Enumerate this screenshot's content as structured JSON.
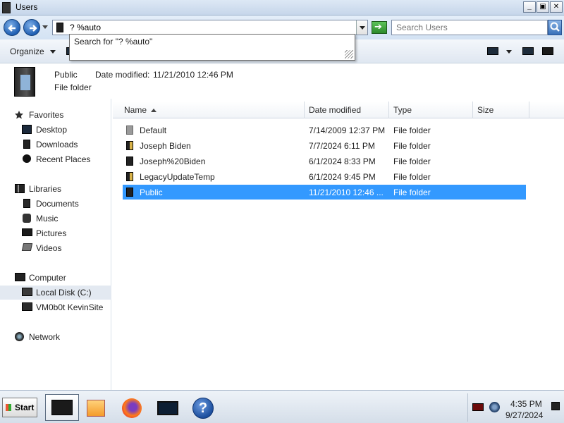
{
  "window": {
    "title": "Users"
  },
  "address": {
    "value": "? %auto",
    "autocomplete_item": "Search for \"? %auto\""
  },
  "search": {
    "placeholder": "Search Users"
  },
  "toolbar": {
    "organize_label": "Organize"
  },
  "details": {
    "name": "Public",
    "type": "File folder",
    "date_modified_label": "Date modified:",
    "date_modified_value": "11/21/2010 12:46 PM"
  },
  "sidebar": {
    "favorites": {
      "label": "Favorites",
      "items": [
        "Desktop",
        "Downloads",
        "Recent Places"
      ]
    },
    "libraries": {
      "label": "Libraries",
      "items": [
        "Documents",
        "Music",
        "Pictures",
        "Videos"
      ]
    },
    "computer": {
      "label": "Computer",
      "items": [
        "Local Disk (C:)",
        "VM0b0t KevinSite"
      ]
    },
    "network": {
      "label": "Network"
    }
  },
  "columns": [
    "Name",
    "Date modified",
    "Type",
    "Size"
  ],
  "files": [
    {
      "name": "Default",
      "date": "7/14/2009 12:37 PM",
      "type": "File folder"
    },
    {
      "name": "Joseph Biden",
      "date": "7/7/2024 6:11 PM",
      "type": "File folder"
    },
    {
      "name": "Joseph%20Biden",
      "date": "6/1/2024 8:33 PM",
      "type": "File folder"
    },
    {
      "name": "LegacyUpdateTemp",
      "date": "6/1/2024 9:45 PM",
      "type": "File folder"
    },
    {
      "name": "Public",
      "date": "11/21/2010 12:46 ...",
      "type": "File folder"
    }
  ],
  "taskbar": {
    "start_label": "Start",
    "time": "4:35 PM",
    "date": "9/27/2024"
  },
  "colors": {
    "selection": "#3399ff",
    "accent": "#1f5fb3"
  }
}
